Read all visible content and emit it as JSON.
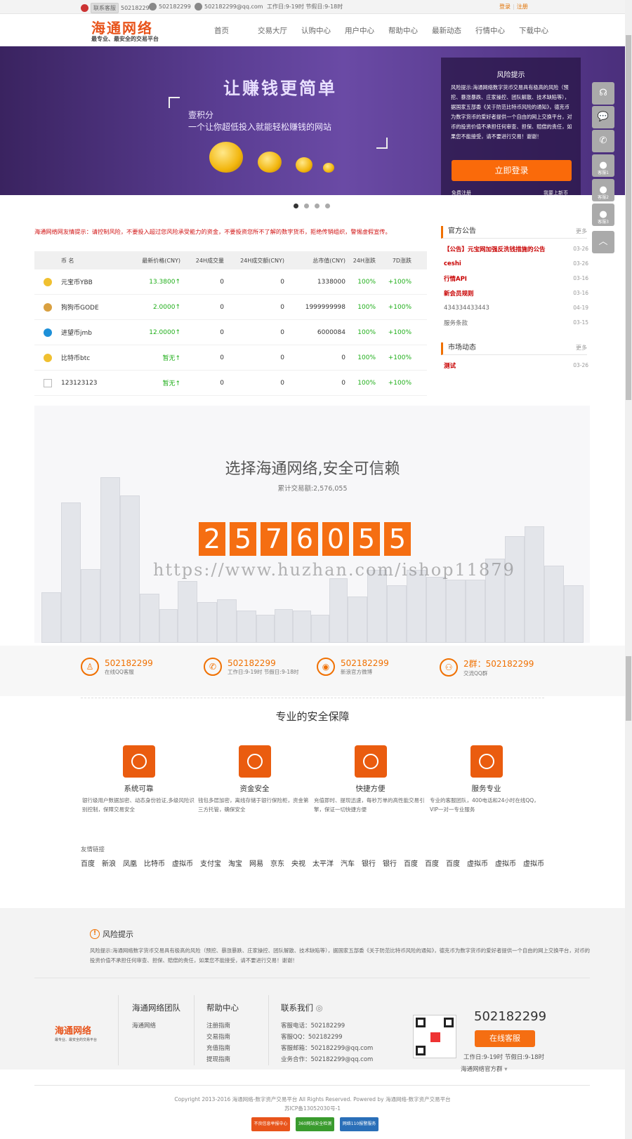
{
  "topbar": {
    "service_label": "联系客服",
    "qq": "502182299",
    "phone": "502182299",
    "email": "502182299@qq.com",
    "hours": "工作日:9-19时 节假日:9-18时",
    "login": "登录",
    "register": "注册"
  },
  "header": {
    "logo": "海通网络",
    "logo_sub": "最专业、最安全的交易平台",
    "nav": [
      "首页",
      "交易大厅",
      "认购中心",
      "用户中心",
      "帮助中心",
      "最新动态",
      "行情中心",
      "下载中心"
    ]
  },
  "banner": {
    "slogan": "让赚钱更简单",
    "line1": "壹积分",
    "line2": "一个让你超低投入就能轻松赚钱的网站",
    "risk_title": "风险提示",
    "risk_text": "风险提示:海通网络数字货币交易具有极高的风险（预挖、暴涨暴跌、庄家操控、团队解散、技术缺陷等），据国家五部委《关于防范比特币风险的通知》，德克币为数字货币的爱好者提供一个自由的网上交换平台，对币的投资价值不承担任何审查、担保、赔偿的责任，如果您不能接受，请不要进行交易！谢谢！",
    "login_button": "立即登录",
    "free_register": "免费注册",
    "forgot": "我要上新币"
  },
  "float_buttons": [
    {
      "icon": "headset-icon",
      "label": ""
    },
    {
      "icon": "wechat-icon",
      "label": ""
    },
    {
      "icon": "phone-icon",
      "label": ""
    },
    {
      "icon": "qq-icon",
      "label": "客服1"
    },
    {
      "icon": "qq-icon",
      "label": "客服2"
    },
    {
      "icon": "qq-icon",
      "label": "客服3"
    },
    {
      "icon": "chevron-up-icon",
      "label": ""
    }
  ],
  "market": {
    "warning": "海通网络网友情提示：请控制风险，不要投入超过您风险承受能力的资金，不要投资您所不了解的数字货币，拒绝传销组织，警惕虚假宣传。",
    "headers": [
      "币 名",
      "最新价格(CNY)",
      "24H成交量",
      "24H成交额(CNY)",
      "总市值(CNY)",
      "24H涨跌",
      "7D涨跌"
    ],
    "rows": [
      {
        "name": "元宝币YBB",
        "price": "13.3800↑",
        "vol": "0",
        "amount": "0",
        "cap": "1338000",
        "d1": "100%",
        "d7": "+100%",
        "icon_color": "#f0c030"
      },
      {
        "name": "狗狗币GODE",
        "price": "2.0000↑",
        "vol": "0",
        "amount": "0",
        "cap": "1999999998",
        "d1": "100%",
        "d7": "+100%",
        "icon_color": "#d9a040"
      },
      {
        "name": "进望币jmb",
        "price": "12.0000↑",
        "vol": "0",
        "amount": "0",
        "cap": "6000084",
        "d1": "100%",
        "d7": "+100%",
        "icon_color": "#1e90d8"
      },
      {
        "name": "比特币btc",
        "price": "暂无↑",
        "vol": "0",
        "amount": "0",
        "cap": "0",
        "d1": "100%",
        "d7": "+100%",
        "icon_color": "#f0c030"
      },
      {
        "name": "123123123",
        "price": "暂无↑",
        "vol": "0",
        "amount": "0",
        "cap": "0",
        "d1": "100%",
        "d7": "+100%",
        "icon_color": "#ffffff"
      }
    ]
  },
  "notices": {
    "title": "官方公告",
    "more": "更多",
    "items": [
      {
        "text": "【公告】元宝网加强反洗钱措施的公告",
        "date": "03-26",
        "style": "red"
      },
      {
        "text": "ceshi",
        "date": "03-26",
        "style": "red"
      },
      {
        "text": "行情API",
        "date": "03-16",
        "style": "red"
      },
      {
        "text": "新会员规则",
        "date": "03-16",
        "style": "red"
      },
      {
        "text": "434334433443",
        "date": "04-19",
        "style": "gray"
      },
      {
        "text": "服务条款",
        "date": "03-15",
        "style": "gray"
      }
    ]
  },
  "market_news": {
    "title": "市场动态",
    "more": "更多",
    "items": [
      {
        "text": "测试",
        "date": "03-26",
        "style": "red"
      }
    ]
  },
  "stats": {
    "title": "选择海通网络,安全可信赖",
    "subtitle": "累计交易额:2,576,055",
    "digits": [
      "2",
      "5",
      "7",
      "6",
      "0",
      "5",
      "5"
    ],
    "watermark": "https://www.huzhan.com/ishop11879"
  },
  "contacts": [
    {
      "icon": "qq-icon",
      "number": "502182299",
      "sub": "在线QQ客服"
    },
    {
      "icon": "phone-icon",
      "number": "502182299",
      "sub": "工作日:9-19时 节假日:9-18时"
    },
    {
      "icon": "weibo-icon",
      "number": "502182299",
      "sub": "新浪官方微博"
    },
    {
      "icon": "group-icon",
      "number": "2群：502182299",
      "sub": "交流QQ群"
    }
  ],
  "security": {
    "title": "专业的安全保障",
    "items": [
      {
        "icon": "shield-icon",
        "name": "系统可靠",
        "desc": "银行级用户数据加密、动态身份验证,多级风险识别控制，保障交易安全"
      },
      {
        "icon": "lock-icon",
        "name": "资金安全",
        "desc": "钱包多层加密，离线存储于银行保险柜，资金第三方托管，确保安全"
      },
      {
        "icon": "lightning-icon",
        "name": "快捷方便",
        "desc": "充值即时、提现迅速，每秒万单的高性能交易引擎，保证一切快捷方便"
      },
      {
        "icon": "heart-icon",
        "name": "服务专业",
        "desc": "专业的客服团队，400电话和24小时在线QQ，VIP一对一专业服务"
      }
    ]
  },
  "friend_links": {
    "title": "友情链接",
    "links": [
      "百度",
      "新浪",
      "凤凰",
      "比特币",
      "虚拟币",
      "支付宝",
      "淘宝",
      "网易",
      "京东",
      "央视",
      "太平洋",
      "汽车",
      "银行",
      "银行",
      "百度",
      "百度",
      "百度",
      "虚拟币",
      "虚拟币",
      "虚拟币"
    ]
  },
  "risk": {
    "title": "风险提示",
    "text": "风险提示:海通网络数字货币交易具有极高的风险（预挖、暴涨暴跌、庄家操控、团队解散、技术缺陷等），据国家五部委《关于防范比特币风险的通知》，德克币为数字货币的爱好者提供一个自由的网上交换平台，对币的投资价值不承担任何审查、担保、赔偿的责任，如果您不能接受，请不要进行交易！谢谢！"
  },
  "footer": {
    "logo": "海通网络",
    "logo_sub": "最专业、最安全的交易平台",
    "team_title": "海通网络团队",
    "team_items": [
      "海通网络"
    ],
    "help_title": "帮助中心",
    "help_items": [
      "注册指南",
      "交易指南",
      "充值指南",
      "提现指南"
    ],
    "contact_title": "联系我们",
    "contact_items": [
      "客服电话：502182299",
      "客服QQ：502182299",
      "客服邮箱：502182299@qq.com",
      "业务合作：502182299@qq.com"
    ],
    "phone": "502182299",
    "online_service": "在线客服",
    "hours": "工作日:9-19时 节假日:9-18时",
    "official": "海通网络官方群",
    "copyright": "Copyright 2013-2016 海通网络-数字资产交易平台 All Rights Reserved. Powered by 海通网络-数字资产交易平台",
    "icp": "苏ICP备13052030号-1",
    "badges": [
      "不良信息举报中心",
      "360网站安全检测",
      "网络110报警服务"
    ]
  }
}
